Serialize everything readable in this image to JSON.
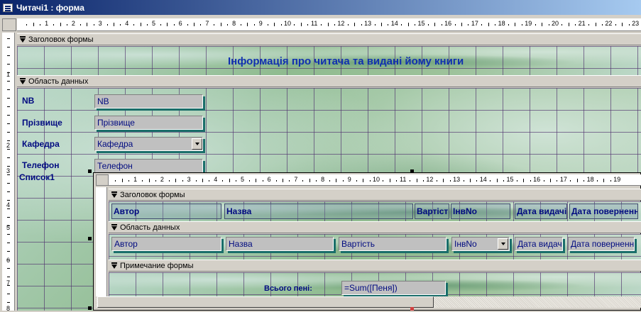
{
  "window": {
    "title": "Читачі1 : форма"
  },
  "ruler_main": [
    "1",
    "2",
    "3",
    "4",
    "5",
    "6",
    "7",
    "8",
    "9",
    "10",
    "11",
    "12",
    "13",
    "14",
    "15",
    "16",
    "17",
    "18",
    "19",
    "20",
    "21",
    "22",
    "23"
  ],
  "ruler_sub": [
    "1",
    "2",
    "3",
    "4",
    "5",
    "6",
    "7",
    "8",
    "9",
    "10",
    "11",
    "12",
    "13",
    "14",
    "15",
    "16",
    "17",
    "18",
    "19"
  ],
  "ruler_vertical": [
    "1",
    "2",
    "3",
    "4",
    "5",
    "6",
    "7",
    "8"
  ],
  "sections": {
    "form_header": "Заголовок формы",
    "detail": "Область данных",
    "form_footer": "Примечание формы"
  },
  "form_title": "Інформація про читача та видані йому книги",
  "main_fields": [
    {
      "label": "NB",
      "value": "NB"
    },
    {
      "label": "Прізвище",
      "value": "Прізвище"
    },
    {
      "label": "Кафедра",
      "value": "Кафедра"
    },
    {
      "label": "Телефон",
      "value": "Телефон"
    }
  ],
  "subform_label": "Список1",
  "subform": {
    "headers": [
      "Автор",
      "Назва",
      "Вартість",
      "ІнвNo",
      "Дата видачі",
      "Дата повернення"
    ],
    "fields": [
      "Автор",
      "Назва",
      "Вартість",
      "ІнвNo",
      "Дата видачі",
      "Дата повернення"
    ],
    "footer_label": "Всього пені:",
    "footer_value": "=Sum([Пеня])"
  },
  "colors": {
    "label": "#000a80",
    "title": "#1030b0",
    "titlebar": "#0a246a"
  }
}
